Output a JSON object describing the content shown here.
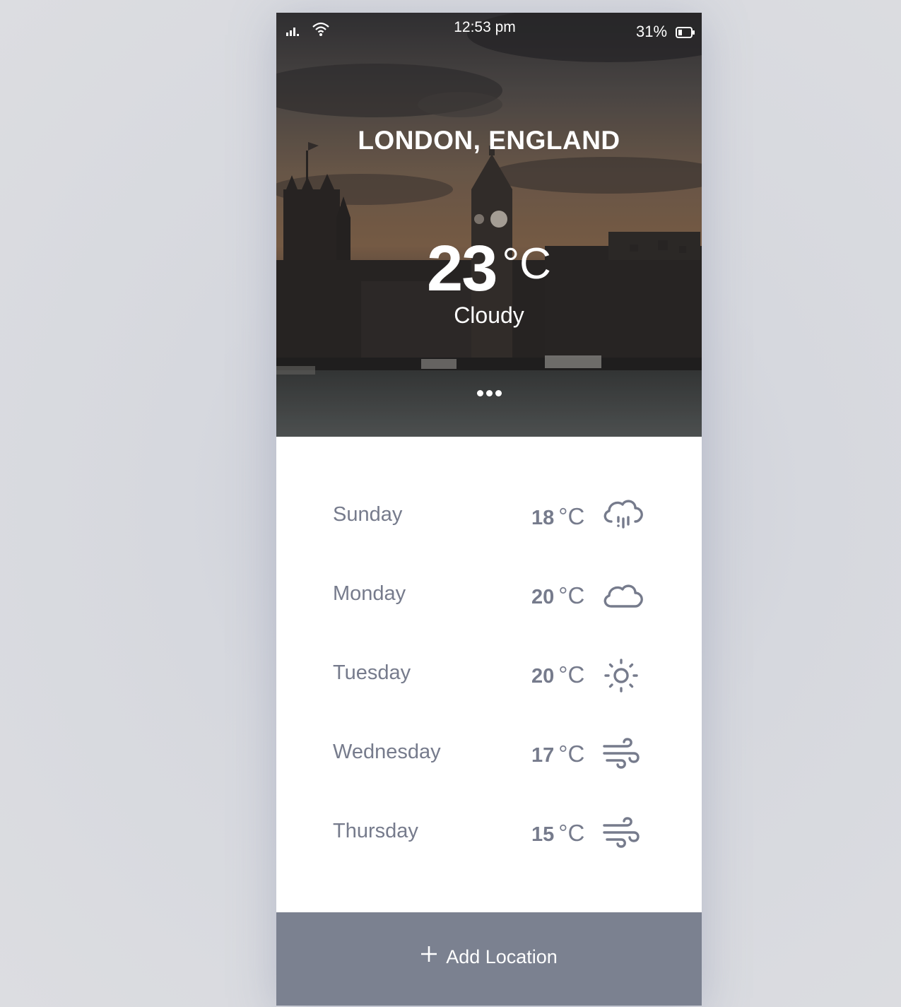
{
  "status_bar": {
    "time": "12:53 pm",
    "battery_percent": "31%",
    "signal_icon": "signal-icon",
    "wifi_icon": "wifi-icon",
    "battery_icon": "battery-icon",
    "battery_level": 0.31
  },
  "current": {
    "location": "LONDON, ENGLAND",
    "temperature": "23",
    "unit": "°C",
    "condition": "Cloudy",
    "page_dots": 3
  },
  "forecast": [
    {
      "day": "Sunday",
      "temp": "18",
      "unit": "°C",
      "icon": "cloud-rain-icon"
    },
    {
      "day": "Monday",
      "temp": "20",
      "unit": "°C",
      "icon": "cloud-icon"
    },
    {
      "day": "Tuesday",
      "temp": "20",
      "unit": "°C",
      "icon": "sun-icon"
    },
    {
      "day": "Wednesday",
      "temp": "17",
      "unit": "°C",
      "icon": "wind-icon"
    },
    {
      "day": "Thursday",
      "temp": "15",
      "unit": "°C",
      "icon": "wind-icon"
    }
  ],
  "add_location": {
    "label": "Add Location",
    "icon": "plus-icon"
  },
  "colors": {
    "forecast_text": "#767b8c",
    "button_bg": "#7b8190",
    "page_bg": "#d9dadf"
  }
}
